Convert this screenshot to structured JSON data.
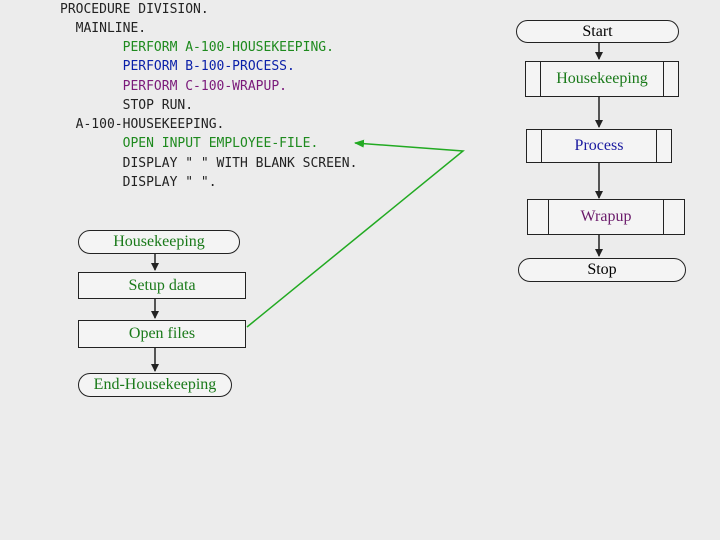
{
  "colors": {
    "background": "#ececec",
    "code_default": "#222222",
    "code_housekeeping": "#1e8a1e",
    "code_process": "#0a1fa8",
    "code_wrapup": "#7a1a7a",
    "label_blue": "#1a1aa0",
    "label_green": "#1a7a1a",
    "label_purple": "#6a1a6a",
    "arrow_green": "#22aa22"
  },
  "code": {
    "lines": [
      "PROCEDURE DIVISION.",
      "  MAINLINE.",
      "        PERFORM A-100-HOUSEKEEPING.",
      "        PERFORM B-100-PROCESS.",
      "        PERFORM C-100-WRAPUP.",
      "        STOP RUN.",
      "  A-100-HOUSEKEEPING.",
      "        OPEN INPUT EMPLOYEE-FILE.",
      "        DISPLAY \" \" WITH BLANK SCREEN.",
      "        DISPLAY \" \"."
    ]
  },
  "main_flow": {
    "start": "Start",
    "housekeeping": "Housekeeping",
    "process": "Process",
    "wrapup": "Wrapup",
    "stop": "Stop"
  },
  "sub_flow": {
    "housekeeping": "Housekeeping",
    "setup": "Setup data",
    "open_files": "Open files",
    "end": "End-Housekeeping"
  }
}
